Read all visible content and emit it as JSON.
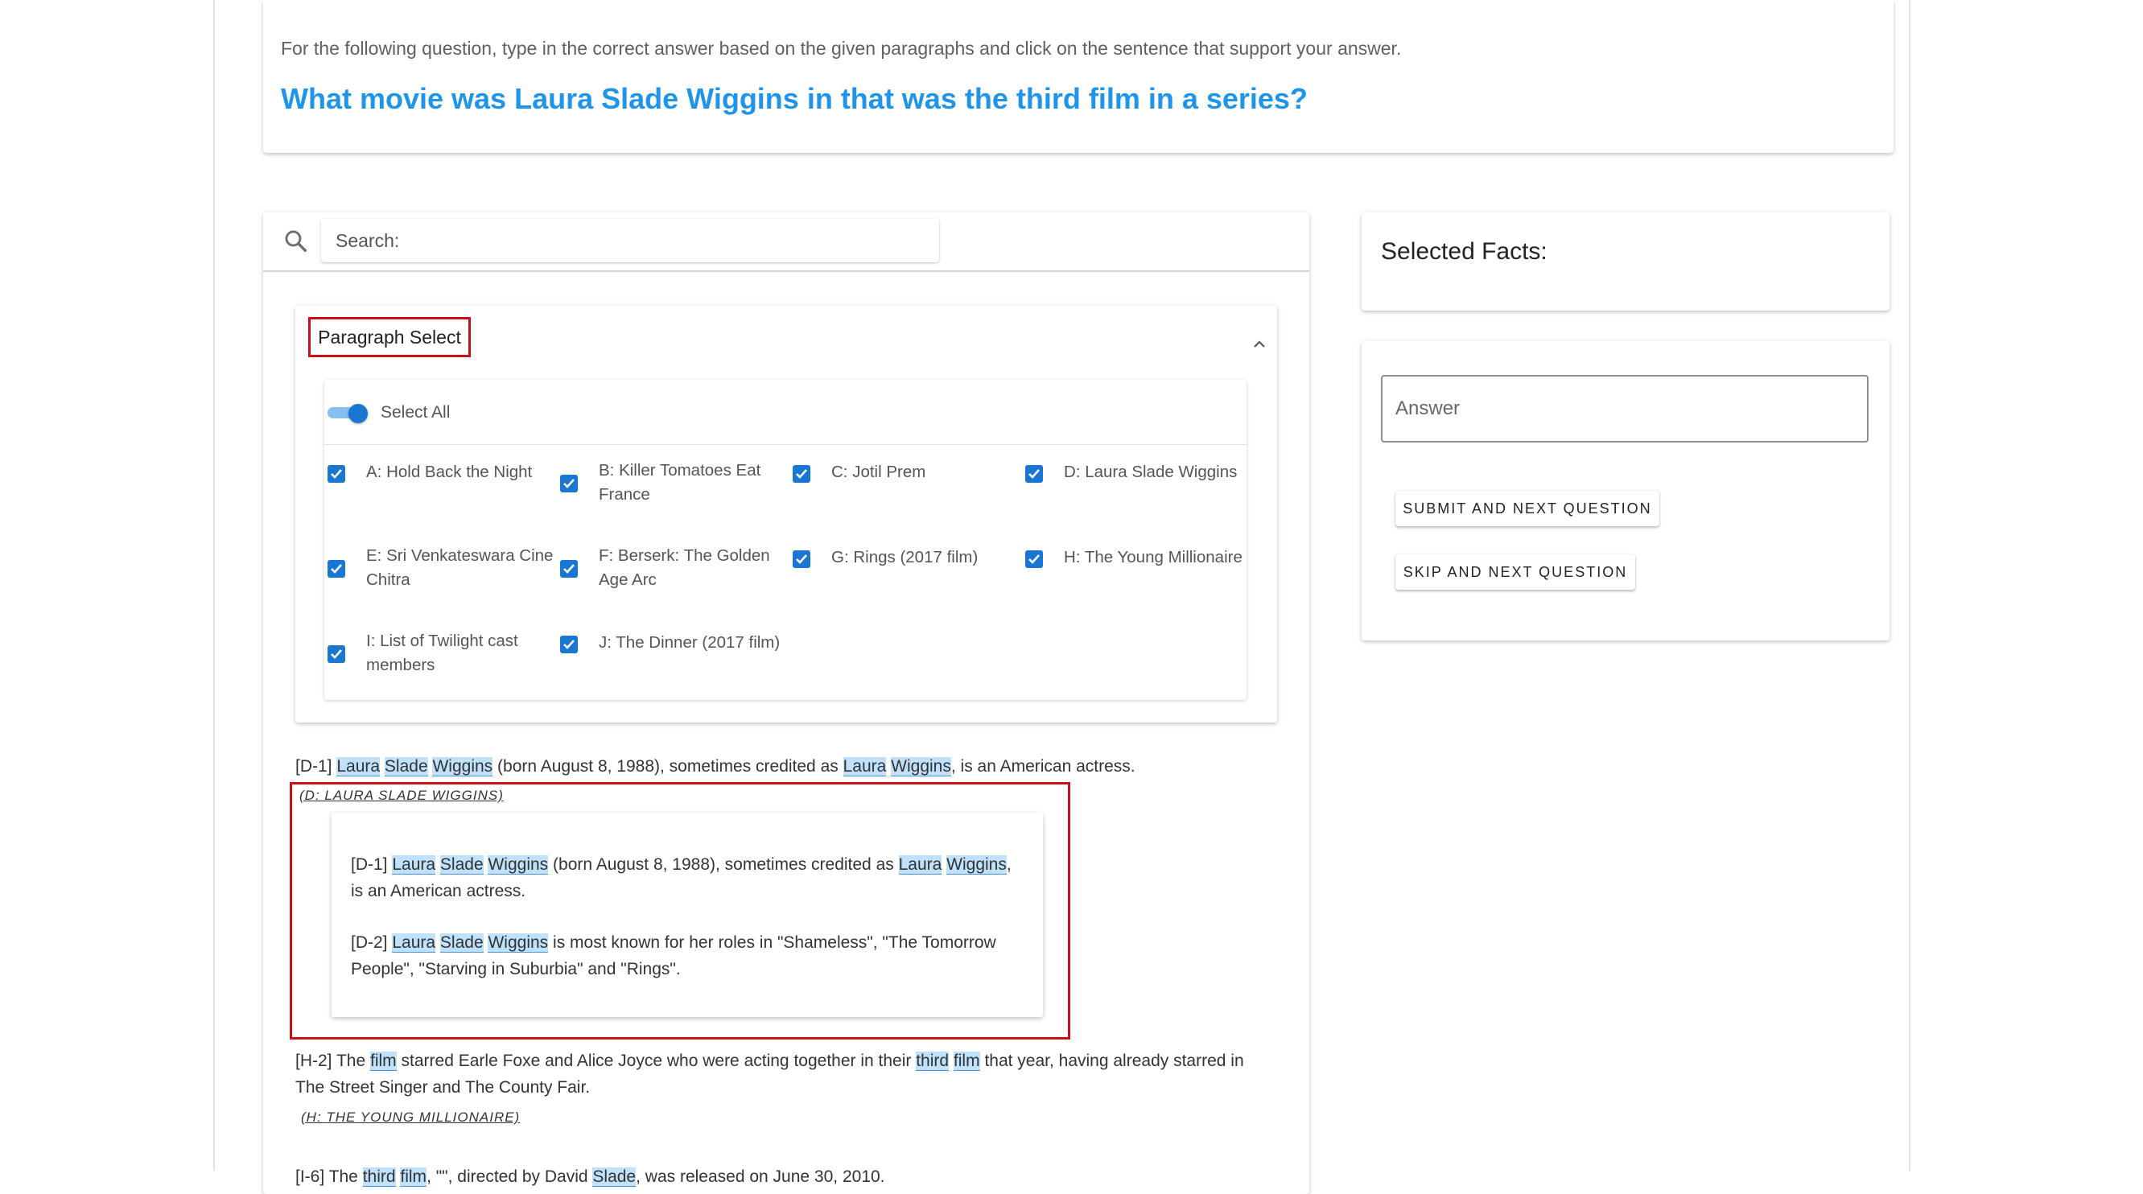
{
  "header": {
    "instruction": "For the following question, type in the correct answer based on the given paragraphs and click on the sentence that support your answer.",
    "question": "What movie was Laura Slade Wiggins in that was the third film in a series?"
  },
  "search": {
    "icon": "search-icon",
    "placeholder": "Search:"
  },
  "paragraph_select": {
    "title": "Paragraph Select",
    "collapse_icon": "chevron-up-icon",
    "select_all_label": "Select All",
    "select_all_on": true,
    "accent": "#1976d2",
    "options": [
      {
        "label": "A: Hold Back the Night",
        "checked": true
      },
      {
        "label": "B: Killer Tomatoes Eat France",
        "checked": true
      },
      {
        "label": "C: Jotil Prem",
        "checked": true
      },
      {
        "label": "D: Laura Slade Wiggins",
        "checked": true
      },
      {
        "label": "E: Sri Venkateswara Cine Chitra",
        "checked": true
      },
      {
        "label": "F: Berserk: The Golden Age Arc",
        "checked": true
      },
      {
        "label": "G: Rings (2017 film)",
        "checked": true
      },
      {
        "label": "H: The Young Millionaire",
        "checked": true
      },
      {
        "label": "I: List of Twilight cast members",
        "checked": true
      },
      {
        "label": "J: The Dinner (2017 film)",
        "checked": true
      }
    ]
  },
  "results": {
    "d1": {
      "id": "[D-1]",
      "t1": "Laura",
      "t2": "Slade",
      "t3": "Wiggins",
      "t4": "(born August 8, 1988), sometimes credited as",
      "t5": "Laura",
      "t6": "Wiggins",
      "t7": ", is an American actress."
    },
    "d_source": "(D: LAURA SLADE WIGGINS)",
    "popup": {
      "d1": {
        "id": "[D-1]",
        "t1": "Laura",
        "t2": "Slade",
        "t3": "Wiggins",
        "t4": "(born August 8, 1988), sometimes credited as",
        "t5": "Laura",
        "t6": "Wiggins",
        "t7": ",",
        "t8": "is an American actress."
      },
      "d2": {
        "id": "[D-2]",
        "t1": "Laura",
        "t2": "Slade",
        "t3": "Wiggins",
        "t4": "is most known for her roles in \"Shameless\", \"The Tomorrow",
        "t5": "People\", \"Starving in Suburbia\" and \"Rings\"."
      }
    },
    "h2": {
      "id": "[H-2]",
      "t1": "The",
      "t2": "film",
      "t3": "starred Earle Foxe and Alice Joyce who were acting together in their",
      "t4": "third",
      "t5": "film",
      "t6": "that year, having already starred in",
      "t7": "The Street Singer and The County Fair."
    },
    "h_source": "(H: THE YOUNG MILLIONAIRE)",
    "i6": {
      "id": "[I-6]",
      "t1": "The",
      "t2": "third",
      "t3": "film",
      "t4": ", \"\", directed by David",
      "t5": "Slade",
      "t6": ", was released on June 30, 2010."
    }
  },
  "selected_facts": {
    "title": "Selected Facts:"
  },
  "answer": {
    "placeholder": "Answer",
    "submit_label": "SUBMIT AND NEXT QUESTION",
    "skip_label": "SKIP AND NEXT QUESTION"
  }
}
